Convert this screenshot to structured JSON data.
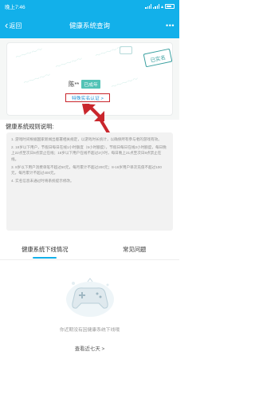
{
  "status_bar": {
    "time": "晚上7:46",
    "battery": ""
  },
  "nav": {
    "back_label": "返回",
    "title": "健康系统查询",
    "more": "•••"
  },
  "card": {
    "name": "陈**",
    "badge": "已成年",
    "verify_button": "特殊实名认证 >",
    "stamp": "已实名"
  },
  "rules": {
    "title": "健康系统规则说明:",
    "items": [
      "1. 游戏时间根据国家新闻出版署相关规定，以游戏时长统计，以确保所有参与者的游戏有效。",
      "2. 18岁以下用户，节假日每日在线1小时额度（5小时额度），节假日每日在线3小时额度，每日晚上22点至次日8点禁止在线；16岁以下用户在线不超过2小时，每日晚上21点至次日8点禁止在线。",
      "3. 8岁以下用户消费单笔不超过50元，每月累计不超过200元；8-16岁用户单次充值不超过100元，每月累计不超过400元。",
      "4. 实名信息未通过时将系统提示修改。"
    ]
  },
  "tabs": [
    {
      "label": "健康系统下线情况",
      "active": true
    },
    {
      "label": "常见问题",
      "active": false
    }
  ],
  "empty": {
    "message": "你近期没有因健康系统下线哦",
    "link": "查看近七天 >"
  },
  "colors": {
    "brand": "#12b0ea",
    "highlight": "#c9262c",
    "accent": "#53c3b6"
  },
  "icons": [
    "back-chevron-icon",
    "more-icon",
    "signal-icon",
    "wifi-icon",
    "battery-icon",
    "gamepad-icon"
  ]
}
